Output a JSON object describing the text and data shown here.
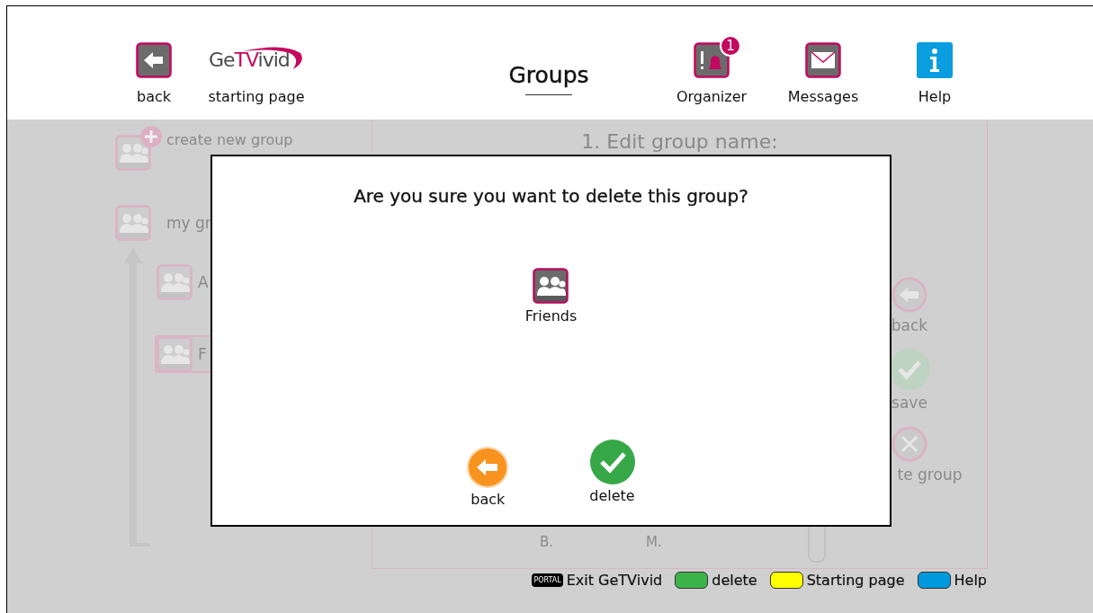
{
  "header": {
    "nav": [
      {
        "kind": "back",
        "label": "back"
      },
      {
        "kind": "logo",
        "label": "starting page",
        "logo": [
          {
            "text": "Ge",
            "highlight": false
          },
          {
            "text": "TV",
            "highlight": true
          },
          {
            "text": "ivid",
            "highlight": false
          }
        ]
      }
    ],
    "title": "Groups",
    "tools": [
      {
        "kind": "organizer",
        "label": "Organizer",
        "badge": "1"
      },
      {
        "kind": "messages",
        "label": "Messages"
      },
      {
        "kind": "help",
        "label": "Help"
      }
    ]
  },
  "sidebar": {
    "create": "create new group",
    "my_groups": "my gr",
    "groups": [
      {
        "label": "A",
        "selected": false
      },
      {
        "label": "F",
        "selected": true
      }
    ]
  },
  "editor": {
    "heading": "1. Edit group name:",
    "actions": [
      {
        "kind": "back",
        "label": "back"
      },
      {
        "kind": "save",
        "label": "save"
      },
      {
        "kind": "delete",
        "label": "te group"
      }
    ],
    "letters": [
      "B.",
      "M."
    ]
  },
  "dialog": {
    "question": "Are you sure you want to delete this group?",
    "group": "Friends",
    "buttons": [
      {
        "kind": "back",
        "label": "back"
      },
      {
        "kind": "delete",
        "label": "delete"
      }
    ]
  },
  "legend": [
    {
      "kind": "portal",
      "key": "PORTAL",
      "label": "Exit GeTVivid"
    },
    {
      "kind": "color",
      "color": "#3cb44a",
      "label": "delete"
    },
    {
      "kind": "color",
      "color": "#ffff00",
      "label": "Starting page"
    },
    {
      "kind": "color",
      "color": "#0099dd",
      "label": "Help"
    }
  ]
}
